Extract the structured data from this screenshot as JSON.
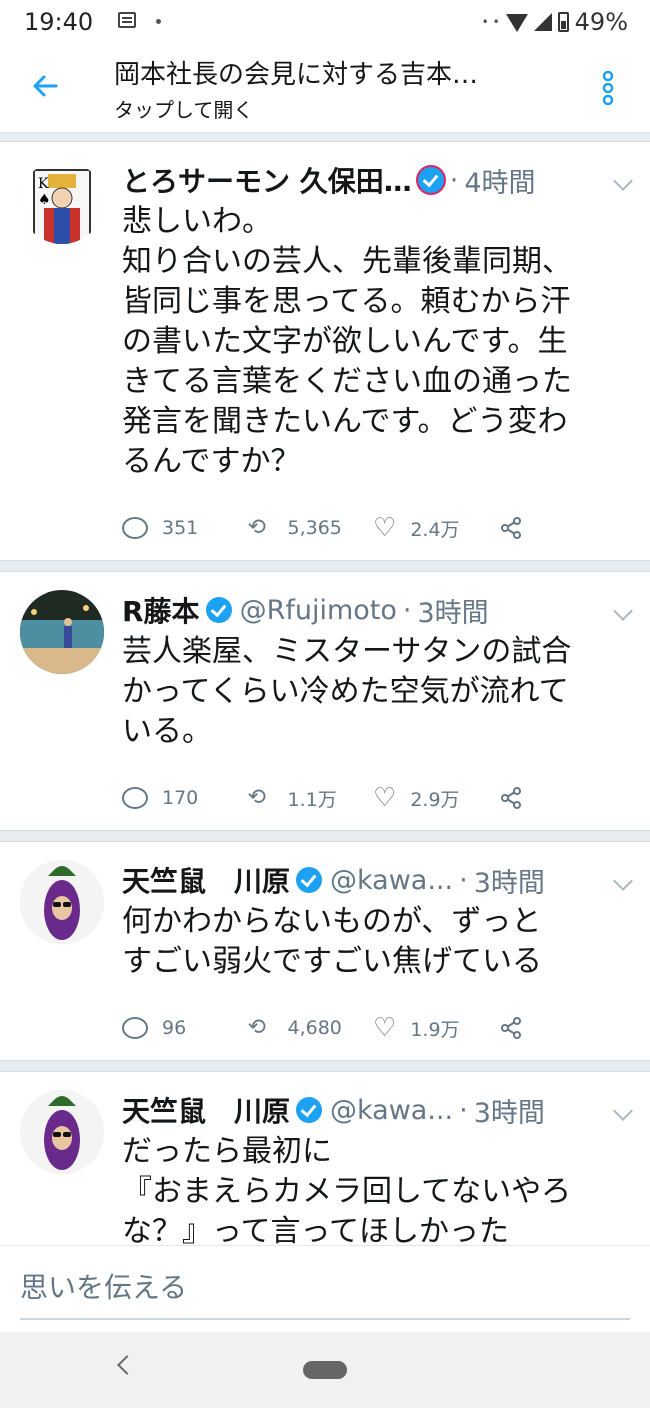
{
  "status_bar": {
    "time": "19:40",
    "battery": "49%"
  },
  "header": {
    "title": "岡本社長の会見に対する吉本…",
    "subtitle": "タップして開く"
  },
  "tweets": [
    {
      "name": "とろサーモン 久保田…",
      "handle": "",
      "sep": "·",
      "time": "4時間",
      "text": "悲しいわ。\n知り合いの芸人、先輩後輩同期、\n皆同じ事を思ってる。頼むから汗\nの書いた文字が欲しいんです。生\nきてる言葉をください血の通った\n発言を聞きたいんです。どう変わ\nるんですか？",
      "replies": "351",
      "retweets": "5,365",
      "likes": "2.4万"
    },
    {
      "name": "R藤本",
      "handle": "@Rfujimoto",
      "sep": "·",
      "time": "3時間",
      "text": "芸人楽屋、ミスターサタンの試合\nかってくらい冷めた空気が流れて\nいる。",
      "replies": "170",
      "retweets": "1.1万",
      "likes": "2.9万"
    },
    {
      "name": "天竺鼠　川原",
      "handle": "@kawa...",
      "sep": "·",
      "time": "3時間",
      "text": "何かわからないものが、ずっと\nすごい弱火ですごい焦げている",
      "replies": "96",
      "retweets": "4,680",
      "likes": "1.9万"
    },
    {
      "name": "天竺鼠　川原",
      "handle": "@kawa...",
      "sep": "·",
      "time": "3時間",
      "text": "だったら最初に\n『おまえらカメラ回してないやろ\nな？』って言ってほしかった"
    }
  ],
  "composer": {
    "placeholder": "思いを伝える"
  },
  "colors": {
    "accent": "#1da1f2",
    "muted": "#657786",
    "text": "#14171a"
  }
}
